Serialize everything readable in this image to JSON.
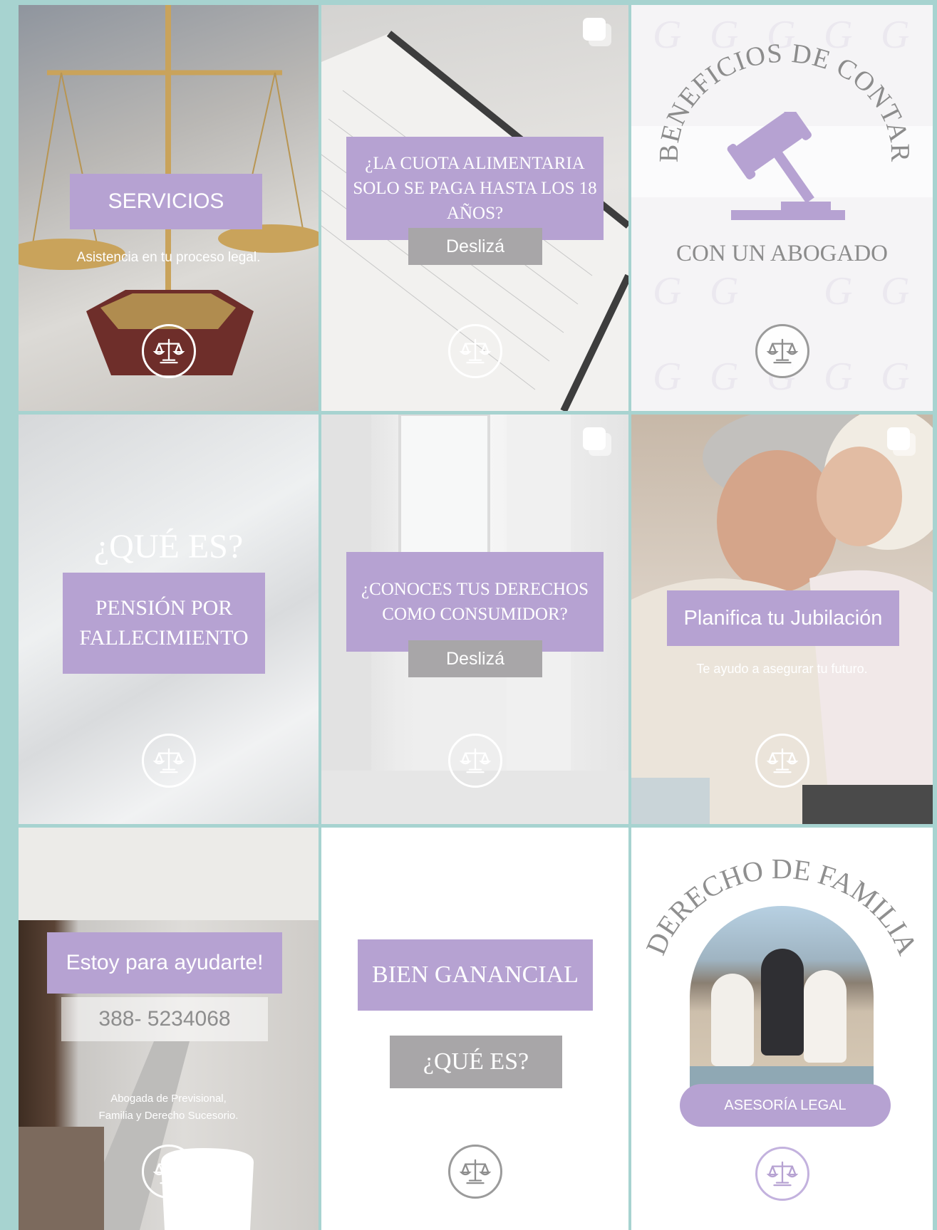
{
  "colors": {
    "background": "#a7d3d0",
    "accent_lavender": "#b6a2d2",
    "accent_grey": "#a8a6a8"
  },
  "posts": [
    {
      "title": "SERVICIOS",
      "subtitle": "Asistencia en tu proceso legal.",
      "icon": "scales-of-justice-icon"
    },
    {
      "title": "¿LA CUOTA ALIMENTARIA SOLO SE PAGA HASTA LOS 18 AÑOS?",
      "button": "Deslizá",
      "icon": "scales-of-justice-icon",
      "carousel_icon": "multiple-images-icon"
    },
    {
      "arc_text": "BENEFICIOS DE CONTAR",
      "title": "CON UN ABOGADO",
      "icon": "scales-of-justice-icon",
      "illustration": "gavel-icon"
    },
    {
      "heading": "¿QUÉ ES?",
      "title": "PENSIÓN POR FALLECIMIENTO",
      "icon": "scales-of-justice-icon"
    },
    {
      "title": "¿CONOCES TUS DERECHOS COMO CONSUMIDOR?",
      "button": "Deslizá",
      "icon": "scales-of-justice-icon",
      "carousel_icon": "multiple-images-icon"
    },
    {
      "title": "Planifica tu Jubilación",
      "subtitle": "Te ayudo a asegurar tu futuro.",
      "icon": "scales-of-justice-icon",
      "carousel_icon": "multiple-images-icon"
    },
    {
      "title": "Estoy para ayudarte!",
      "phone": "388- 5234068",
      "footer_line1": "Abogada de Previsional,",
      "footer_line2": "Familia y Derecho Sucesorio.",
      "icon": "scales-of-justice-icon"
    },
    {
      "title": "BIEN GANANCIAL",
      "subtitle": "¿QUÉ ES?",
      "icon": "scales-of-justice-icon"
    },
    {
      "arc_text": "DERECHO DE FAMILIA",
      "pill": "ASESORÍA LEGAL",
      "icon": "scales-of-justice-icon"
    }
  ]
}
